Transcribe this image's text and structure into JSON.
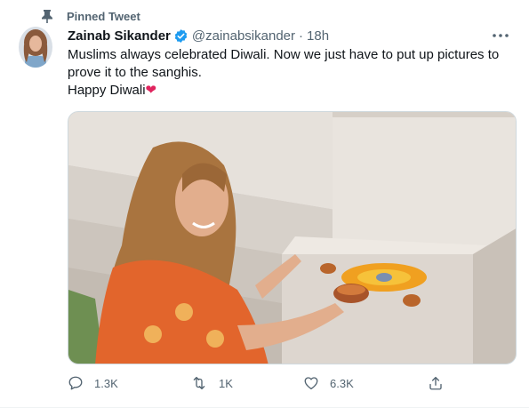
{
  "pinned": {
    "label": "Pinned Tweet",
    "icon": "pin-icon"
  },
  "author": {
    "display_name": "Zainab Sikander",
    "handle": "@zainabsikander",
    "separator": "·",
    "timestamp": "18h",
    "verified": true
  },
  "tweet": {
    "line1": "Muslims always celebrated Diwali. Now we just have to put up pictures to prove it to the sanghis.",
    "line2": "Happy Diwali",
    "emoji": "❤"
  },
  "actions": {
    "reply_count": "1.3K",
    "retweet_count": "1K",
    "like_count": "6.3K"
  },
  "colors": {
    "secondary_text": "#536471",
    "verified_blue": "#1d9bf0",
    "heart_red": "#e0245e"
  }
}
